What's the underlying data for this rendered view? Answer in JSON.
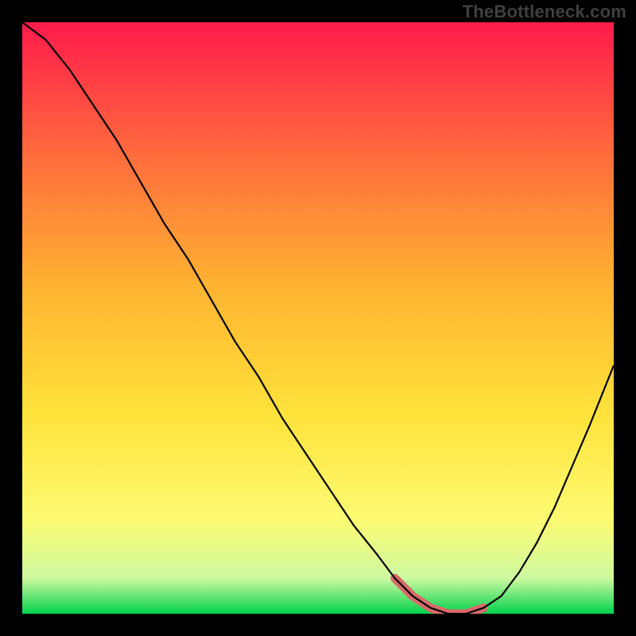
{
  "attribution": "TheBottleneck.com",
  "colors": {
    "gradient_top": "#ff1a4b",
    "gradient_mid1": "#ff6a3d",
    "gradient_mid2": "#ffb431",
    "gradient_mid3": "#ffe23a",
    "gradient_mid4": "#fdfb72",
    "gradient_mid5": "#cdf9a0",
    "gradient_bottom": "#04d24c",
    "curve": "#000000",
    "highlight": "#d96a6a",
    "frame": "#000000"
  },
  "chart_data": {
    "type": "line",
    "title": "",
    "xlabel": "",
    "ylabel": "",
    "xlim": [
      0,
      100
    ],
    "ylim": [
      0,
      100
    ],
    "grid": false,
    "legend": false,
    "series": [
      {
        "name": "bottleneck-curve",
        "x": [
          0,
          4,
          8,
          12,
          16,
          20,
          24,
          28,
          32,
          36,
          40,
          44,
          48,
          52,
          56,
          60,
          63,
          66,
          69,
          72,
          75,
          78,
          81,
          84,
          87,
          90,
          93,
          96,
          100
        ],
        "y": [
          100,
          97,
          92,
          86,
          80,
          73,
          66,
          60,
          53,
          46,
          40,
          33,
          27,
          21,
          15,
          10,
          6,
          3,
          1,
          0,
          0,
          1,
          3,
          7,
          12,
          18,
          25,
          32,
          42
        ]
      }
    ],
    "highlight_range": {
      "x_start": 62,
      "x_end": 80
    }
  }
}
